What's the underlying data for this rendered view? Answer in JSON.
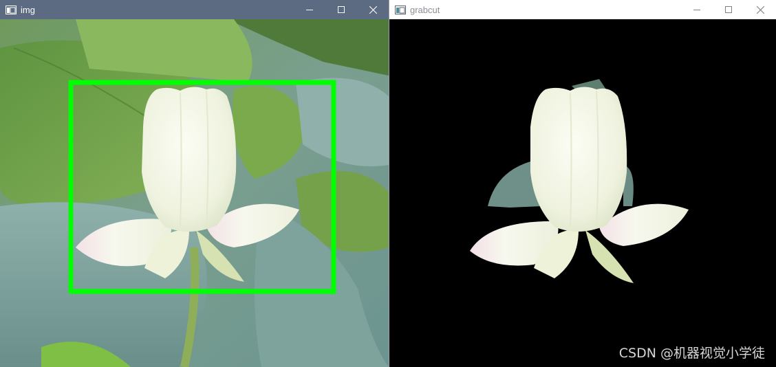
{
  "windows": [
    {
      "title": "img",
      "active": true
    },
    {
      "title": "grabcut",
      "active": false
    }
  ],
  "controls": {
    "minimize": "minimize-icon",
    "maximize": "maximize-icon",
    "close": "close-icon"
  },
  "colors": {
    "selection_rect": "#00ff00",
    "active_titlebar": "#5d6b82",
    "result_background": "#000000"
  },
  "watermark": "CSDN @机器视觉小学徒"
}
